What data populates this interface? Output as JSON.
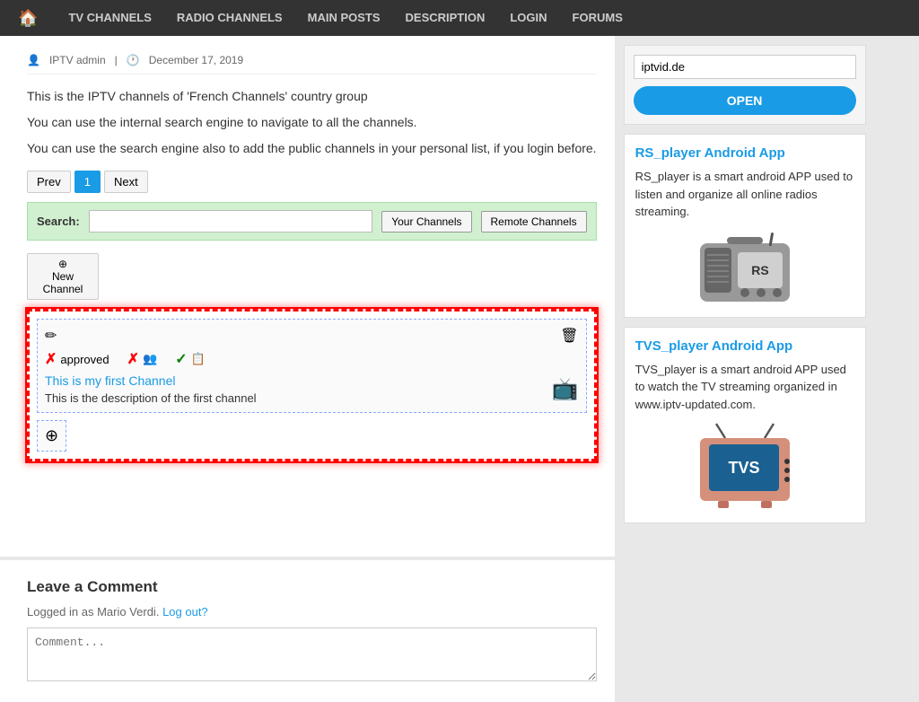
{
  "nav": {
    "home_icon": "🏠",
    "items": [
      {
        "label": "TV CHANNELS",
        "href": "#"
      },
      {
        "label": "RADIO CHANNELS",
        "href": "#"
      },
      {
        "label": "MAIN POSTS",
        "href": "#"
      },
      {
        "label": "DESCRIPTION",
        "href": "#"
      },
      {
        "label": "LOGIN",
        "href": "#"
      },
      {
        "label": "FORUMS",
        "href": "#"
      }
    ]
  },
  "post": {
    "author_icon": "👤",
    "author": "IPTV admin",
    "date_icon": "🕐",
    "date": "December 17, 2019",
    "desc1": "This is the IPTV channels of 'French Channels' country group",
    "desc2": "You can use the internal search engine to navigate to all the channels.",
    "desc3": "You can use the search engine also to add the public channels in your personal list, if you login before.",
    "pagination": {
      "prev_label": "Prev",
      "page_label": "1",
      "next_label": "Next"
    },
    "search": {
      "label": "Search:",
      "placeholder": "",
      "your_channels_label": "Your Channels",
      "remote_channels_label": "Remote Channels"
    },
    "new_channel_label": "New Channel",
    "new_channel_icon": "⊕",
    "channel": {
      "edit_icon": "✏",
      "trash_icon": "🗑",
      "approved_label": "approved",
      "approved_status": "✗",
      "group_status": "✗",
      "group_icon": "👥",
      "visible_status": "✓",
      "preview_icon": "📋",
      "link_text": "This is my first Channel",
      "description": "This is the description of the first channel",
      "tv_icon": "📺",
      "add_icon": "⊕"
    }
  },
  "comments": {
    "title": "Leave a Comment",
    "logged_in_text": "Logged in as Mario Verdi.",
    "logout_link": "Log out?",
    "comment_placeholder": "Comment..."
  },
  "sidebar": {
    "ad": {
      "url": "iptvid.de",
      "open_label": "OPEN"
    },
    "rs_player": {
      "title": "RS_player Android App",
      "description": "RS_player is a smart android APP used to listen and organize all online radios streaming.",
      "rs_label": "RS"
    },
    "tvs_player": {
      "title": "TVS_player Android App",
      "description": "TVS_player is a smart android APP used to watch the TV streaming organized in www.iptv-updated.com.",
      "tvs_label": "TVS"
    }
  }
}
